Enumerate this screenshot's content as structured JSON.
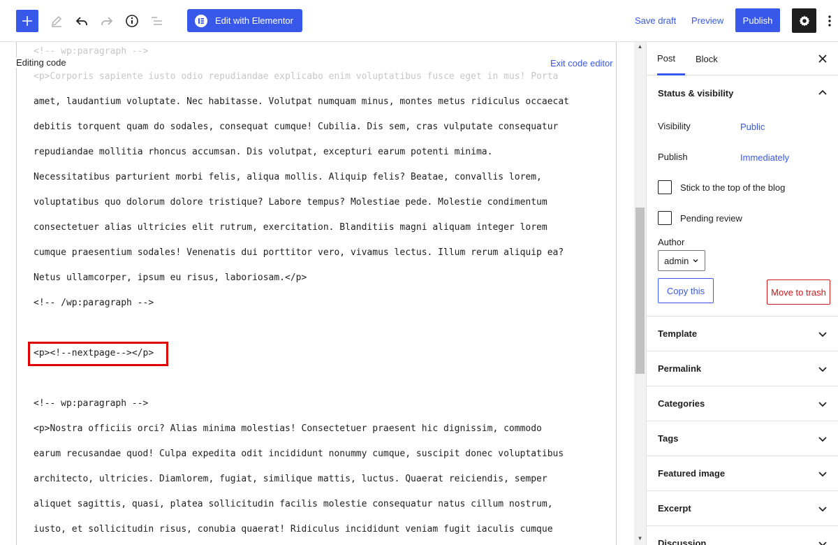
{
  "toolbar": {
    "add_icon": "plus-icon",
    "tools_icon": "pencil-icon",
    "undo_icon": "undo-icon",
    "redo_icon": "redo-icon",
    "info_icon": "info-icon",
    "outline_icon": "list-view-icon",
    "elementor_label": "Edit with Elementor",
    "save_draft_label": "Save draft",
    "preview_label": "Preview",
    "publish_label": "Publish",
    "settings_icon": "gear-icon",
    "more_icon": "more-vertical-icon",
    "accent_color": "#3858e9"
  },
  "editor": {
    "editing_label": "Editing code",
    "exit_label": "Exit code editor",
    "lines": [
      "<!-- wp:paragraph -->",
      "<p>Corporis sapiente iusto odio repudiandae explicabo enim voluptatibus fusce eget in mus! Porta",
      "amet, laudantium voluptate. Nec habitasse. Volutpat numquam minus, montes metus ridiculus occaecat",
      "debitis torquent quam do sodales, consequat cumque! Cubilia. Dis sem, cras vulputate consequatur",
      "repudiandae mollitia rhoncus accumsan. Dis volutpat, excepturi earum potenti minima.",
      "Necessitatibus parturient morbi felis, aliqua mollis. Aliquip felis? Beatae, convallis lorem,",
      "voluptatibus quo dolorum dolore tristique? Labore tempus? Molestiae pede. Molestie condimentum",
      "consectetuer alias ultricies elit rutrum, exercitation. Blanditiis magni aliquam integer lorem",
      "cumque praesentium sodales! Venenatis dui porttitor vero, vivamus lectus. Illum rerum aliquip ea?",
      "Netus ullamcorper, ipsum eu risus, laboriosam.</p>",
      "<!-- /wp:paragraph -->",
      "<p><!--nextpage--></p>",
      "<!-- wp:paragraph -->",
      "<p>Nostra officiis orci? Alias minima molestias! Consectetuer praesent hic dignissim, commodo",
      "earum recusandae quod! Culpa expedita odit incididunt nonummy cumque, suscipit donec voluptatibus",
      "architecto, ultricies. Diamlorem, fugiat, similique mattis, luctus. Quaerat reiciendis, semper",
      "aliquet sagittis, quasi, platea sollicitudin facilis molestie consequatur natus cillum nostrum,",
      "iusto, et sollicitudin risus, conubia quaerat! Ridiculus incididunt veniam fugit iaculis cumque"
    ],
    "highlight_color": "#e00000"
  },
  "sidebar": {
    "tab_post": "Post",
    "tab_block": "Block",
    "close_icon": "close-icon",
    "status": {
      "title": "Status & visibility",
      "visibility_label": "Visibility",
      "visibility_value": "Public",
      "publish_label": "Publish",
      "publish_value": "Immediately",
      "sticky_label": "Stick to the top of the blog",
      "pending_label": "Pending review",
      "author_label": "Author",
      "author_value": "admin",
      "copy_label": "Copy this",
      "trash_label": "Move to trash"
    },
    "panels": [
      "Template",
      "Permalink",
      "Categories",
      "Tags",
      "Featured image",
      "Excerpt",
      "Discussion"
    ]
  }
}
